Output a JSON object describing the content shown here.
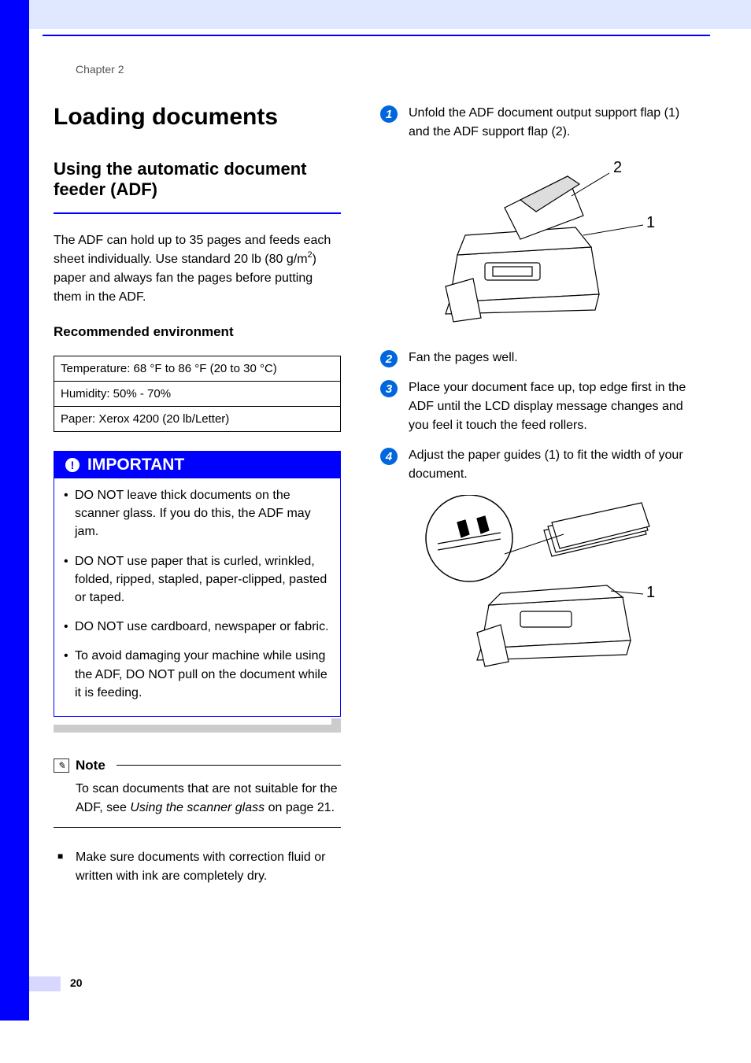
{
  "header": {
    "chapter": "Chapter 2",
    "page_number": "20"
  },
  "title": "Loading documents",
  "section": {
    "heading": "Using the automatic document feeder (ADF)",
    "intro": "The ADF can hold up to 35 pages and feeds each sheet individually. Use standard 20 lb (80 g/m²) paper and always fan the pages before putting them in the ADF.",
    "env_heading": "Recommended environment",
    "env_rows": [
      "Temperature: 68 °F to 86 °F (20 to 30 °C)",
      "Humidity: 50% - 70%",
      "Paper: Xerox 4200 (20 lb/Letter)"
    ]
  },
  "important": {
    "label": "IMPORTANT",
    "items": [
      "DO NOT leave thick documents on the scanner glass. If you do this, the ADF may jam.",
      "DO NOT use paper that is curled, wrinkled, folded, ripped, stapled, paper-clipped, pasted or taped.",
      "DO NOT use cardboard, newspaper or fabric.",
      "To avoid damaging your machine while using the ADF, DO NOT pull on the document while it is feeding."
    ]
  },
  "note": {
    "label": "Note",
    "text_pre": "To scan documents that are not suitable for the ADF, see ",
    "text_italic": "Using the scanner glass",
    "text_post": " on page 21."
  },
  "square_note": "Make sure documents with correction fluid or written with ink are completely dry.",
  "steps": [
    {
      "num": "1",
      "text": "Unfold the ADF document output support flap (1) and the ADF support flap (2)."
    },
    {
      "num": "2",
      "text": "Fan the pages well."
    },
    {
      "num": "3",
      "text": "Place your document face up, top edge first in the ADF until the LCD display message changes and you feel it touch the feed rollers."
    },
    {
      "num": "4",
      "text": "Adjust the paper guides (1) to fit the width of your document."
    }
  ],
  "figure_labels": {
    "fig1_1": "1",
    "fig1_2": "2",
    "fig2_1": "1"
  }
}
